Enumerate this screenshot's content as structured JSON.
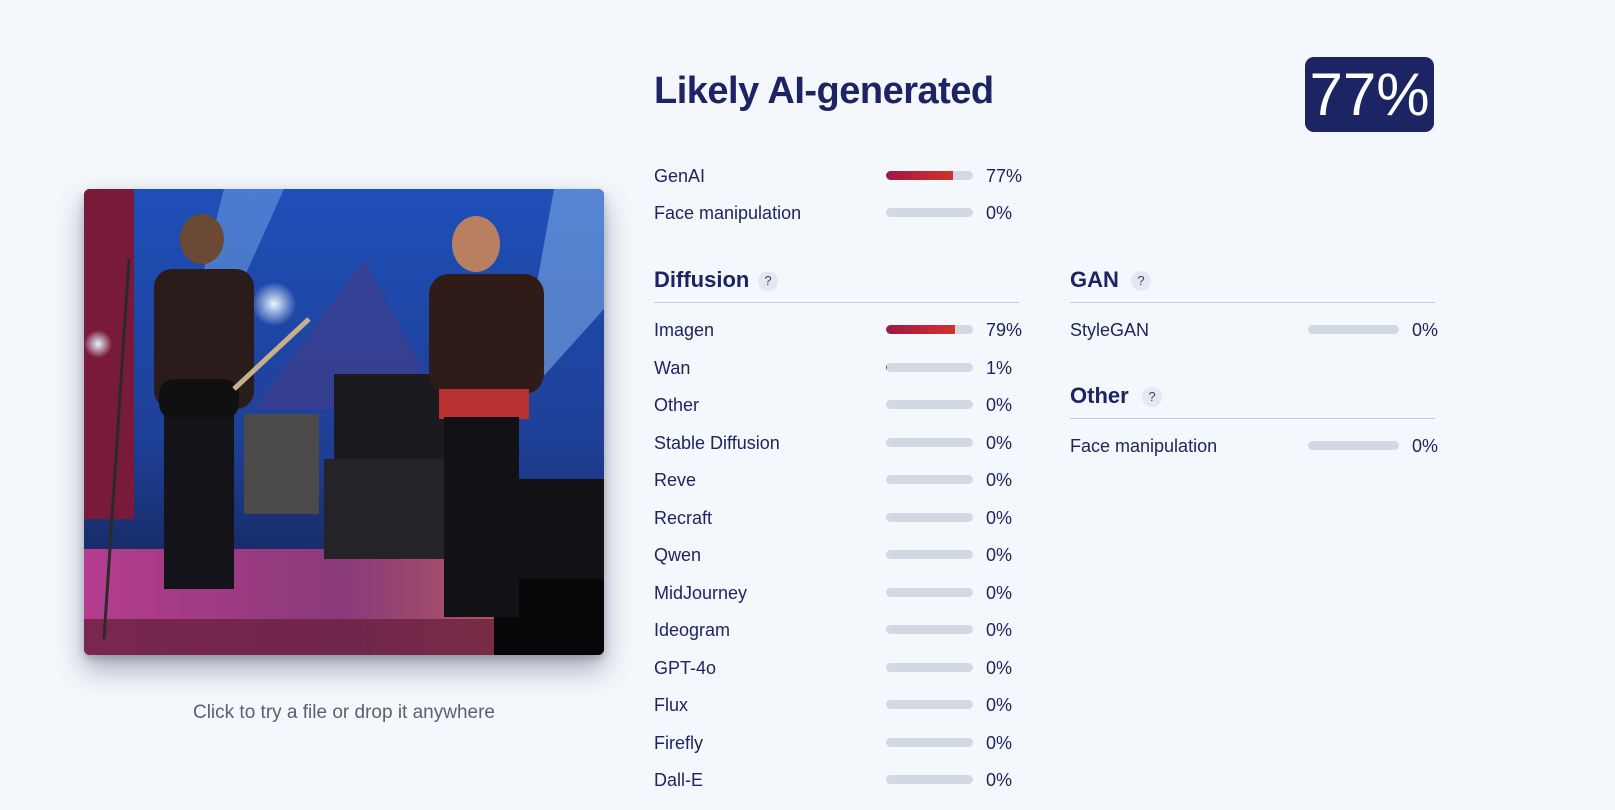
{
  "upload": {
    "hint": "Click to try a file or drop it anywhere"
  },
  "result": {
    "verdict": "Likely AI-generated",
    "score": "77%"
  },
  "summary": [
    {
      "label": "GenAI",
      "percent": "77%",
      "value": 77
    },
    {
      "label": "Face manipulation",
      "percent": "0%",
      "value": 0
    }
  ],
  "diffusion": {
    "title": "Diffusion",
    "help": "?",
    "models": [
      {
        "label": "Imagen",
        "percent": "79%",
        "value": 79
      },
      {
        "label": "Wan",
        "percent": "1%",
        "value": 1
      },
      {
        "label": "Other",
        "percent": "0%",
        "value": 0
      },
      {
        "label": "Stable Diffusion",
        "percent": "0%",
        "value": 0
      },
      {
        "label": "Reve",
        "percent": "0%",
        "value": 0
      },
      {
        "label": "Recraft",
        "percent": "0%",
        "value": 0
      },
      {
        "label": "Qwen",
        "percent": "0%",
        "value": 0
      },
      {
        "label": "MidJourney",
        "percent": "0%",
        "value": 0
      },
      {
        "label": "Ideogram",
        "percent": "0%",
        "value": 0
      },
      {
        "label": "GPT-4o",
        "percent": "0%",
        "value": 0
      },
      {
        "label": "Flux",
        "percent": "0%",
        "value": 0
      },
      {
        "label": "Firefly",
        "percent": "0%",
        "value": 0
      },
      {
        "label": "Dall-E",
        "percent": "0%",
        "value": 0
      }
    ]
  },
  "gan": {
    "title": "GAN",
    "help": "?",
    "models": [
      {
        "label": "StyleGAN",
        "percent": "0%",
        "value": 0
      }
    ]
  },
  "other": {
    "title": "Other",
    "help": "?",
    "models": [
      {
        "label": "Face manipulation",
        "percent": "0%",
        "value": 0
      }
    ]
  },
  "colors": {
    "accent": "#1c2464",
    "bar_fill": "#c42a35",
    "bar_track": "#d2d8e4",
    "background": "#f4f7fb"
  }
}
